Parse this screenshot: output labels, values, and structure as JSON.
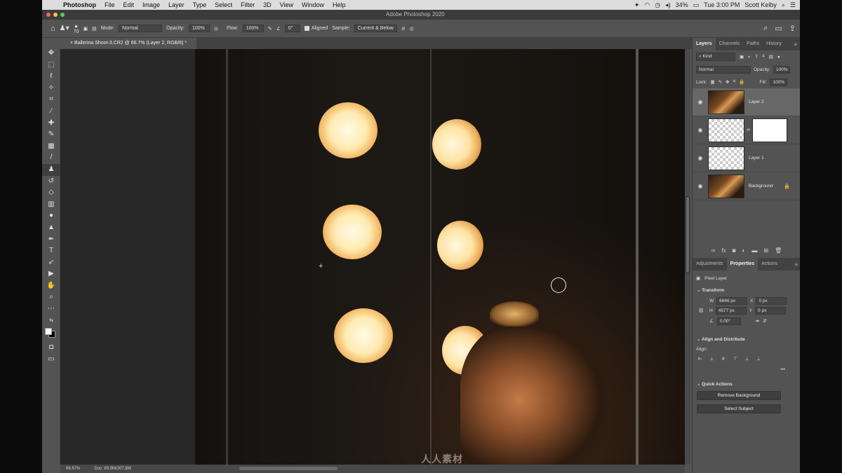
{
  "menubar": {
    "items": [
      "Photoshop",
      "File",
      "Edit",
      "Image",
      "Layer",
      "Type",
      "Select",
      "Filter",
      "3D",
      "View",
      "Window",
      "Help"
    ],
    "window_title": "Adobe Photoshop 2020",
    "battery": "34%",
    "clock": "Tue 3:00 PM",
    "user": "Scott Kelby"
  },
  "options": {
    "brush_size": "70",
    "mode_label": "Mode:",
    "mode_value": "Normal",
    "opacity_label": "Opacity:",
    "opacity_value": "100%",
    "flow_label": "Flow:",
    "flow_value": "100%",
    "angle_value": "0°",
    "aligned_label": "Aligned",
    "sample_label": "Sample:",
    "sample_value": "Current & Below"
  },
  "document": {
    "tab_label": "Ballerina Shoot-3.CR2 @ 66.7% (Layer 2, RGB/8) *"
  },
  "status": {
    "zoom": "66.67%",
    "doc": "Doc: 89.9M/207.8M"
  },
  "layers_panel": {
    "tabs": [
      "Layers",
      "Channels",
      "Paths",
      "History"
    ],
    "filter_value": "Kind",
    "blend_value": "Normal",
    "opacity_label": "Opacity:",
    "opacity_value": "100%",
    "lock_label": "Lock:",
    "fill_label": "Fill:",
    "fill_value": "100%",
    "layers": [
      {
        "name": "Layer 2"
      },
      {
        "name": ""
      },
      {
        "name": "Layer 1"
      },
      {
        "name": "Background"
      }
    ]
  },
  "properties_panel": {
    "tabs": [
      "Adjustments",
      "Properties",
      "Actions"
    ],
    "pixel_layer": "Pixel Layer",
    "transform_title": "Transform",
    "w_label": "W",
    "w_value": "6666 px",
    "h_label": "H",
    "h_value": "4577 px",
    "x_label": "X",
    "x_value": "0 px",
    "y_label": "Y",
    "y_value": "0 px",
    "angle_value": "0.00°",
    "align_title": "Align and Distribute",
    "align_label": "Align:",
    "more": "•••",
    "quick_title": "Quick Actions",
    "remove_bg": "Remove Background",
    "select_subject": "Select Subject"
  },
  "watermark": "人人素材"
}
